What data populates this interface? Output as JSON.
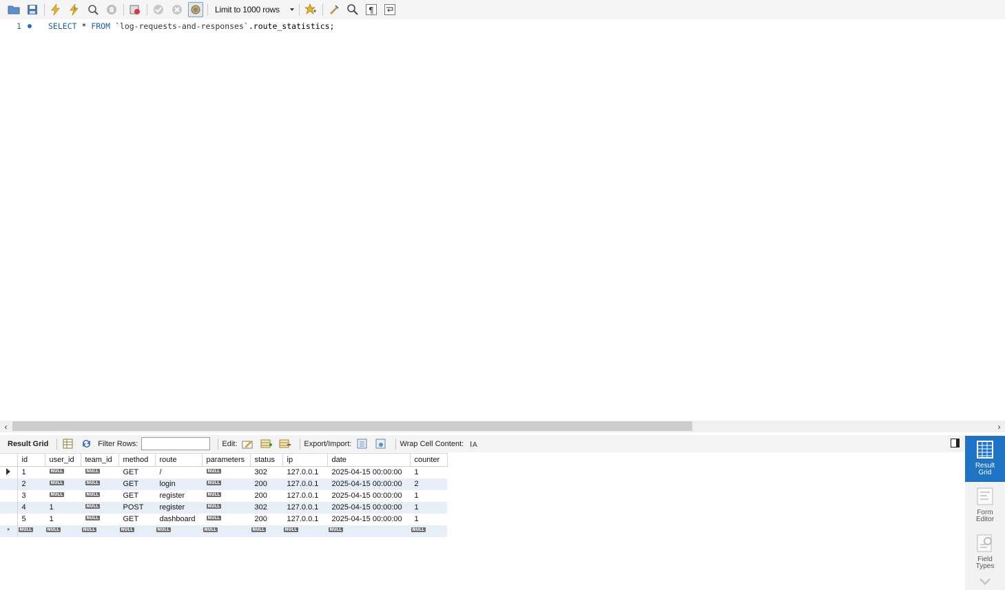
{
  "toolbar": {
    "icons": [
      "open-folder-icon",
      "save-icon",
      "execute-icon",
      "execute-current-icon",
      "explain-icon",
      "stop-icon",
      "toggle-error-icon",
      "commit-icon",
      "rollback-icon",
      "autocommit-icon",
      "bookmark-icon",
      "beautify-icon",
      "find-icon",
      "invisible-chars-icon",
      "wrap-icon"
    ],
    "limit_label": "Limit to 1000 rows"
  },
  "editor": {
    "line_number": "1",
    "tokens": {
      "select": "SELECT",
      "star": " * ",
      "from": "FROM",
      "space": " ",
      "schema": "`log-requests-and-responses`",
      "table": ".route_statistics;"
    }
  },
  "results_toolbar": {
    "result_grid": "Result Grid",
    "filter_rows": "Filter Rows:",
    "edit": "Edit:",
    "export_import": "Export/Import:",
    "wrap_cell": "Wrap Cell Content:"
  },
  "grid": {
    "columns": [
      "id",
      "user_id",
      "team_id",
      "method",
      "route",
      "parameters",
      "status",
      "ip",
      "date",
      "counter"
    ],
    "rows": [
      {
        "id": "1",
        "user_id": null,
        "team_id": null,
        "method": "GET",
        "route": "/",
        "parameters": null,
        "status": "302",
        "ip": "127.0.0.1",
        "date": "2025-04-15 00:00:00",
        "counter": "1"
      },
      {
        "id": "2",
        "user_id": null,
        "team_id": null,
        "method": "GET",
        "route": "login",
        "parameters": null,
        "status": "200",
        "ip": "127.0.0.1",
        "date": "2025-04-15 00:00:00",
        "counter": "2"
      },
      {
        "id": "3",
        "user_id": null,
        "team_id": null,
        "method": "GET",
        "route": "register",
        "parameters": null,
        "status": "200",
        "ip": "127.0.0.1",
        "date": "2025-04-15 00:00:00",
        "counter": "1"
      },
      {
        "id": "4",
        "user_id": "1",
        "team_id": null,
        "method": "POST",
        "route": "register",
        "parameters": null,
        "status": "302",
        "ip": "127.0.0.1",
        "date": "2025-04-15 00:00:00",
        "counter": "1"
      },
      {
        "id": "5",
        "user_id": "1",
        "team_id": null,
        "method": "GET",
        "route": "dashboard",
        "parameters": null,
        "status": "200",
        "ip": "127.0.0.1",
        "date": "2025-04-15 00:00:00",
        "counter": "1"
      }
    ],
    "null_label": "NULL",
    "new_row_marker": "*"
  },
  "side_panel": {
    "result_grid": "Result Grid",
    "form_editor": "Form Editor",
    "field_types": "Field Types",
    "accent": "#1e73c5"
  }
}
